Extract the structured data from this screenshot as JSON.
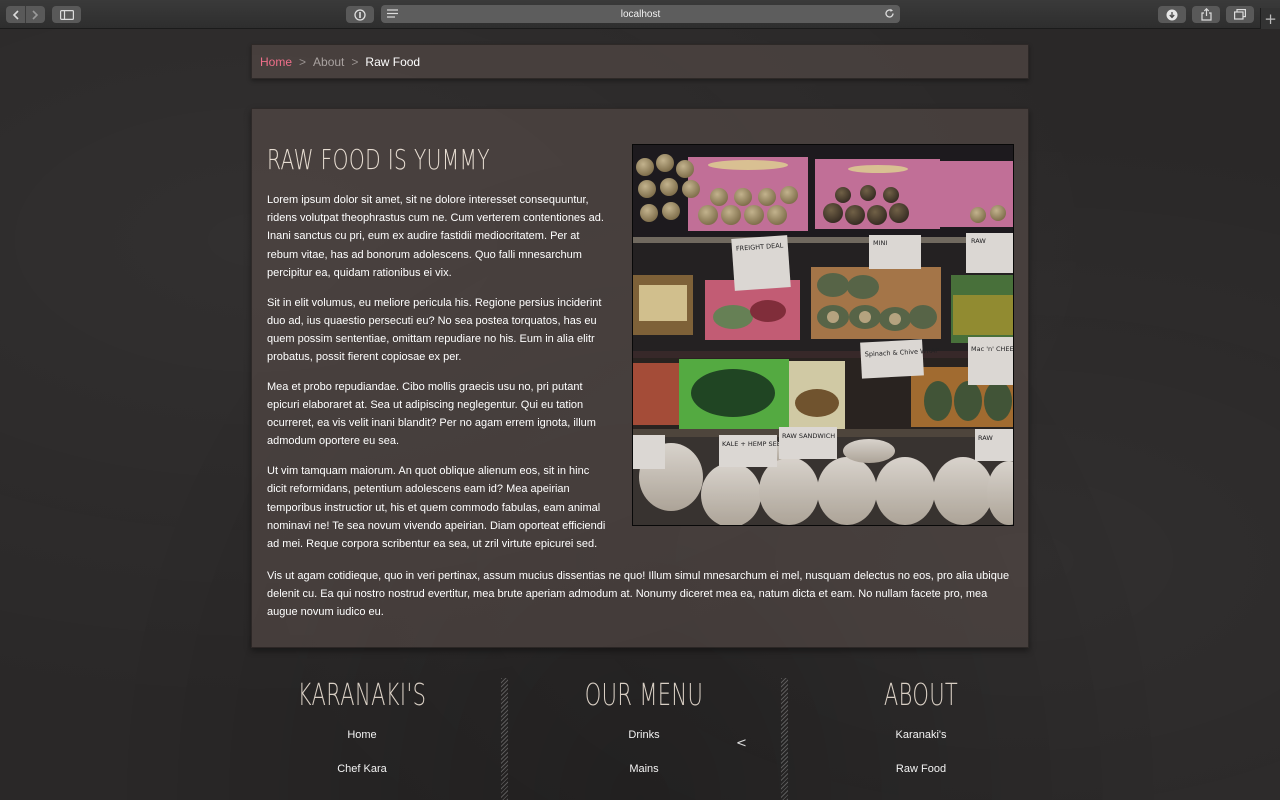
{
  "browser": {
    "url": "localhost"
  },
  "breadcrumb": {
    "home": "Home",
    "separator": ">",
    "about": "About",
    "current": "Raw Food"
  },
  "article": {
    "title": "RAW FOOD IS YUMMY",
    "paragraphs": [
      "Lorem ipsum dolor sit amet, sit ne dolore interesset consequuntur, ridens volutpat theophrastus cum ne. Cum verterem contentiones ad. Inani sanctus cu pri, eum ex audire fastidii mediocritatem. Per at rebum vitae, has ad bonorum adolescens. Quo falli mnesarchum percipitur ea, quidam rationibus ei vix.",
      "Sit in elit volumus, eu meliore pericula his. Regione persius inciderint duo ad, ius quaestio persecuti eu? No sea postea torquatos, has eu quem possim sententiae, omittam repudiare no his. Eum in alia elitr probatus, possit fierent copiosae ex per.",
      "Mea et probo repudiandae. Cibo mollis graecis usu no, pri putant epicuri elaboraret at. Sea ut adipiscing neglegentur. Qui eu tation ocurreret, ea vis velit inani blandit? Per no agam errem ignota, illum admodum oportere eu sea.",
      "Ut vim tamquam maiorum. An quot oblique alienum eos, sit in hinc dicit reformidans, petentium adolescens eam id? Mea apeirian temporibus instructior ut, his et quem commodo fabulas, eam animal nominavi ne! Te sea novum vivendo apeirian. Diam oporteat efficiendi ad mei. Reque corpora scribentur ea sea, ut zril virtute epicurei sed."
    ],
    "closing_paragraph": "Vis ut agam cotidieque, quo in veri pertinax, assum mucius dissentias ne quo! Illum simul mnesarchum ei mel, nusquam delectus no eos, pro alia ubique delenit cu. Ea qui nostro nostrud evertitur, mea brute aperiam admodum at. Nonumy diceret mea ea, natum dicta et eam. No nullam facete pro, mea augue novum iudico eu."
  },
  "photo_signs": {
    "sign1": "FREIGHT DEAL",
    "sign2": "MINI",
    "sign3": "RAW",
    "sign4": "Spinach & Chive WRAP",
    "sign5": "Mac 'n' CHEESE",
    "sign6": "KALE + HEMP SEED SALAD",
    "sign7": "RAW SANDWICH",
    "sign8": "RAW"
  },
  "footer": {
    "col1": {
      "title": "KARANAKI'S",
      "items": [
        "Home",
        "Chef Kara"
      ]
    },
    "col2": {
      "title": "OUR MENU",
      "items": [
        "Drinks",
        "Mains"
      ],
      "chevron": "<"
    },
    "col3": {
      "title": "ABOUT",
      "items": [
        "Karanaki's",
        "Raw Food"
      ]
    }
  },
  "colors": {
    "breadcrumb_active": "#ef6f8a",
    "panel_bg": "#5c504c",
    "heading": "#e7ddd2"
  }
}
